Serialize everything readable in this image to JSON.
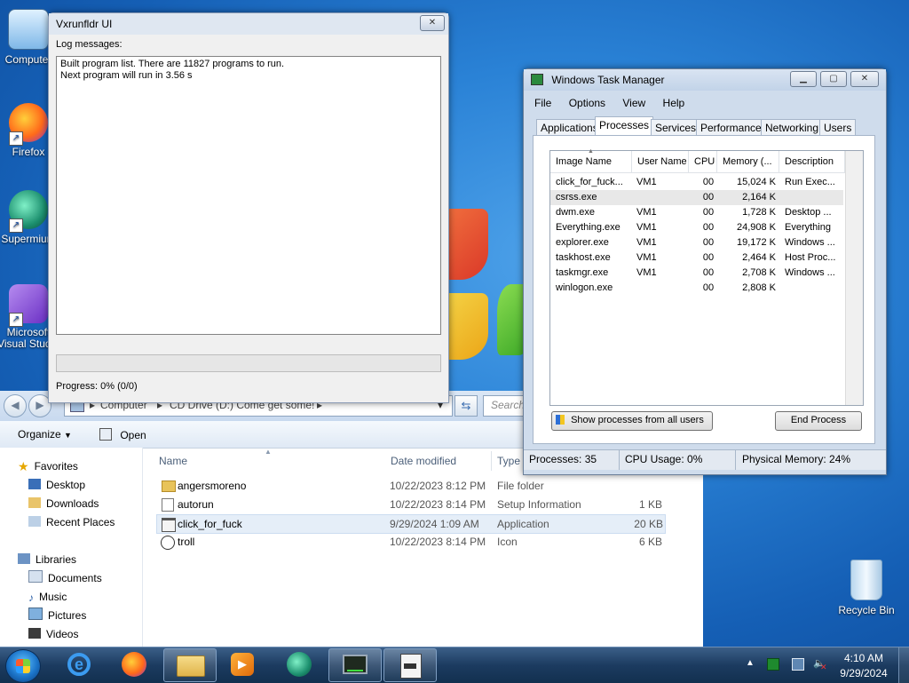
{
  "desktop": {
    "icons": [
      {
        "label": "Computer"
      },
      {
        "label": "Firefox"
      },
      {
        "label": "Supermium"
      },
      {
        "label": "Microsoft Visual Studio"
      }
    ],
    "recycle_bin": "Recycle Bin"
  },
  "vx": {
    "title": "Vxrunfldr UI",
    "log_label": "Log messages:",
    "log_lines": [
      "Built program list. There are 11827 programs to run.",
      "Next program will run in 3.56 s"
    ],
    "progress_text": "Progress: 0% (0/0)",
    "progress_fraction": 0
  },
  "explorer": {
    "breadcrumb": [
      "Computer",
      "CD Drive (D:) Come get some!"
    ],
    "search_placeholder": "Search",
    "toolbar": {
      "organize": "Organize",
      "open": "Open"
    },
    "nav": {
      "favorites": "Favorites",
      "favorites_items": [
        "Desktop",
        "Downloads",
        "Recent Places"
      ],
      "libraries": "Libraries",
      "libraries_items": [
        "Documents",
        "Music",
        "Pictures",
        "Videos"
      ]
    },
    "columns": {
      "name": "Name",
      "date": "Date modified",
      "type": "Type"
    },
    "files": [
      {
        "name": "angersmoreno",
        "date": "10/22/2023 8:12 PM",
        "type": "File folder",
        "size": "",
        "icon": "folder-icon"
      },
      {
        "name": "autorun",
        "date": "10/22/2023 8:14 PM",
        "type": "Setup Information",
        "size": "1 KB",
        "icon": "settings-file-icon"
      },
      {
        "name": "click_for_fuck",
        "date": "9/29/2024 1:09 AM",
        "type": "Application",
        "size": "20 KB",
        "icon": "application-icon"
      },
      {
        "name": "troll",
        "date": "10/22/2023 8:14 PM",
        "type": "Icon",
        "size": "6 KB",
        "icon": "icon-file-icon"
      }
    ]
  },
  "tm": {
    "title": "Windows Task Manager",
    "menu": [
      "File",
      "Options",
      "View",
      "Help"
    ],
    "tabs": [
      "Applications",
      "Processes",
      "Services",
      "Performance",
      "Networking",
      "Users"
    ],
    "active_tab": "Processes",
    "columns": [
      "Image Name",
      "User Name",
      "CPU",
      "Memory (...",
      "Description"
    ],
    "processes": [
      {
        "image": "click_for_fuck...",
        "user": "VM1",
        "cpu": "00",
        "mem": "15,024 K",
        "desc": "Run Exec..."
      },
      {
        "image": "csrss.exe",
        "user": "",
        "cpu": "00",
        "mem": "2,164 K",
        "desc": ""
      },
      {
        "image": "dwm.exe",
        "user": "VM1",
        "cpu": "00",
        "mem": "1,728 K",
        "desc": "Desktop ..."
      },
      {
        "image": "Everything.exe",
        "user": "VM1",
        "cpu": "00",
        "mem": "24,908 K",
        "desc": "Everything"
      },
      {
        "image": "explorer.exe",
        "user": "VM1",
        "cpu": "00",
        "mem": "19,172 K",
        "desc": "Windows ..."
      },
      {
        "image": "taskhost.exe",
        "user": "VM1",
        "cpu": "00",
        "mem": "2,464 K",
        "desc": "Host Proc..."
      },
      {
        "image": "taskmgr.exe",
        "user": "VM1",
        "cpu": "00",
        "mem": "2,708 K",
        "desc": "Windows ..."
      },
      {
        "image": "winlogon.exe",
        "user": "",
        "cpu": "00",
        "mem": "2,808 K",
        "desc": ""
      }
    ],
    "show_all_button": "Show processes from all users",
    "end_process_button": "End Process",
    "status": {
      "processes": "Processes: 35",
      "cpu": "CPU Usage: 0%",
      "memory": "Physical Memory: 24%"
    }
  },
  "taskbar": {
    "time": "4:10 AM",
    "date": "9/29/2024",
    "apps": [
      "internet-explorer-icon",
      "firefox-icon",
      "file-explorer-icon",
      "media-player-icon",
      "supermium-icon",
      "task-manager-icon",
      "vxrunfldr-icon"
    ]
  },
  "colors": {
    "accent": "#1b6fc6",
    "selection": "#e5eef8"
  }
}
